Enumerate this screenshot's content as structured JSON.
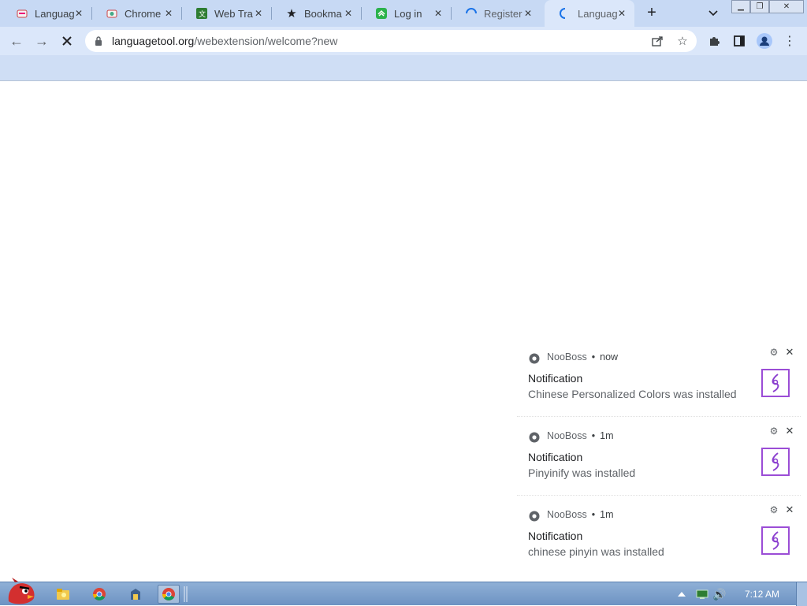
{
  "tabs": [
    {
      "title": "Languag",
      "icon": "languagetool-icon"
    },
    {
      "title": "Chrome",
      "icon": "chrome-webstore-icon"
    },
    {
      "title": "Web Tra",
      "icon": "translate-icon"
    },
    {
      "title": "Bookma",
      "icon": "star-icon"
    },
    {
      "title": "Log in",
      "icon": "feedly-icon"
    },
    {
      "title": "Register",
      "icon": "loading-spinner-icon"
    },
    {
      "title": "Languag",
      "icon": "loading-spinner-icon"
    }
  ],
  "address_bar": {
    "host": "languagetool.org",
    "path": "/webextension/welcome?new"
  },
  "notifications": [
    {
      "app": "NooBoss",
      "time": "now",
      "title": "Notification",
      "message": "Chinese Personalized Colors was installed"
    },
    {
      "app": "NooBoss",
      "time": "1m",
      "title": "Notification",
      "message": "Pinyinify was installed"
    },
    {
      "app": "NooBoss",
      "time": "1m",
      "title": "Notification",
      "message": "chinese pinyin was installed"
    }
  ],
  "taskbar": {
    "clock": "7:12 AM"
  },
  "colors": {
    "tabstrip": "#c7d9f4",
    "toolbar": "#dbe7fa",
    "accent": "#1a73e8",
    "extension": "#9b4dd6"
  }
}
